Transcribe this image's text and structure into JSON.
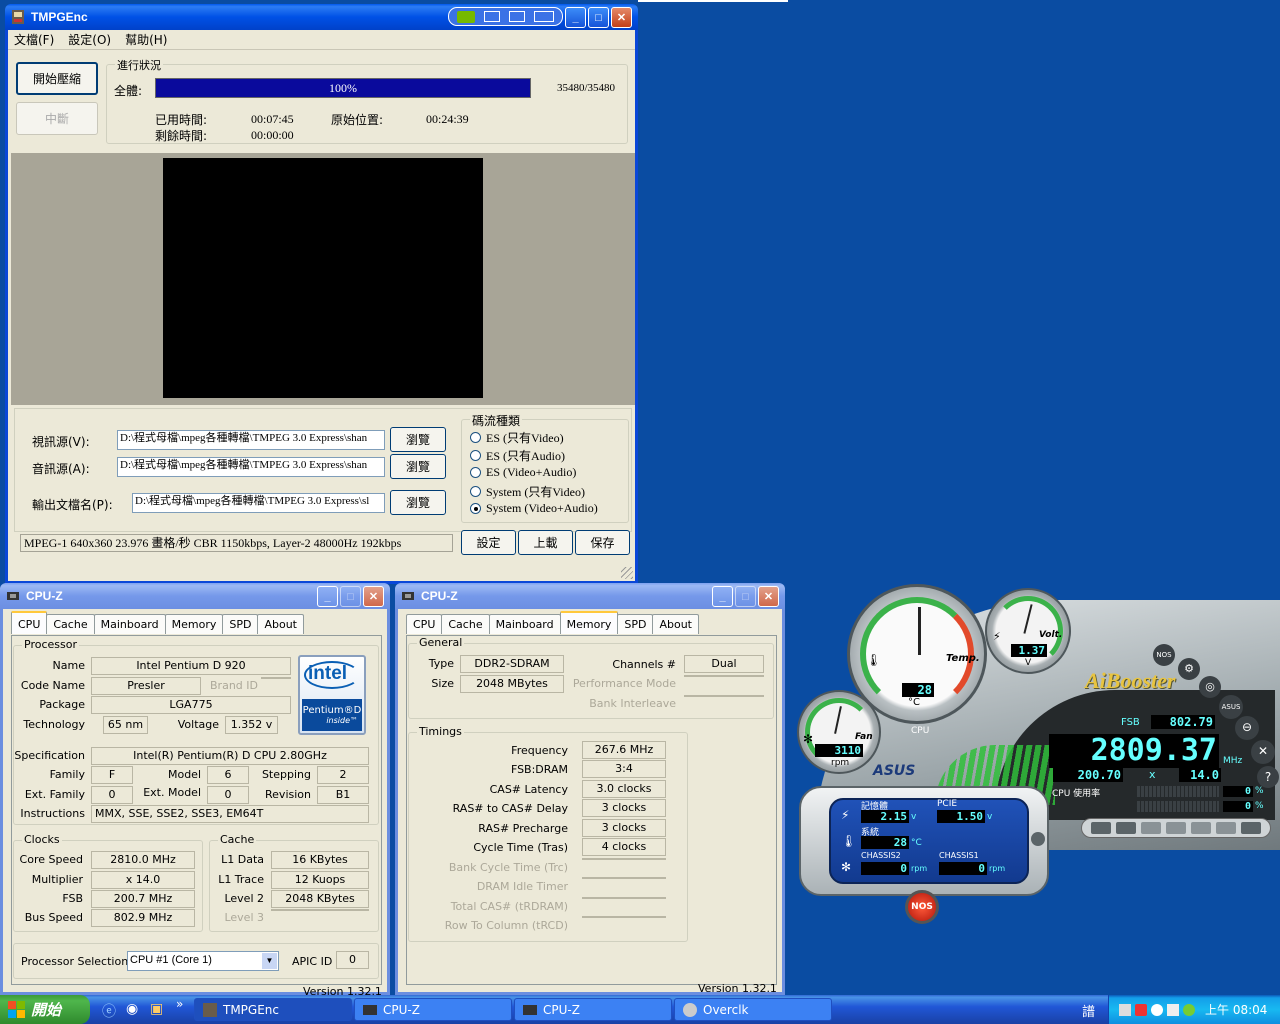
{
  "tmpg": {
    "title": "TMPGEnc",
    "menu": [
      "文檔(F)",
      "設定(O)",
      "幫助(H)"
    ],
    "start_btn": "開始壓縮",
    "stop_btn": "中斷",
    "progress_group": "進行狀況",
    "total_label": "全體:",
    "progress_pct": "100%",
    "progress_fraction": 1.0,
    "frames": "35480/35480",
    "elapsed_label": "已用時間:",
    "elapsed": "00:07:45",
    "remain_label": "剩餘時間:",
    "remain": "00:00:00",
    "orig_pos_label": "原始位置:",
    "orig_pos": "00:24:39",
    "video_label": "視訊源(V):",
    "video_path": "D:\\程式母檔\\mpeg各種轉檔\\TMPEG 3.0 Express\\shan",
    "audio_label": "音訊源(A):",
    "audio_path": "D:\\程式母檔\\mpeg各種轉檔\\TMPEG 3.0 Express\\shan",
    "output_label": "輸出文檔名(P):",
    "output_path": "D:\\程式母檔\\mpeg各種轉檔\\TMPEG 3.0 Express\\sl",
    "browse": "瀏覽",
    "stream_group": "碼流種類",
    "stream_options": [
      "ES (只有Video)",
      "ES (只有Audio)",
      "ES (Video+Audio)",
      "System (只有Video)",
      "System (Video+Audio)"
    ],
    "stream_selected": 4,
    "status": "MPEG-1 640x360 23.976 畫格/秒 CBR 1150kbps, Layer-2 48000Hz 192kbps",
    "setting_btn": "設定",
    "load_btn": "上載",
    "save_btn": "保存"
  },
  "cpuz1": {
    "title": "CPU-Z",
    "tabs": [
      "CPU",
      "Cache",
      "Mainboard",
      "Memory",
      "SPD",
      "About"
    ],
    "active_tab": 0,
    "processor_group": "Processor",
    "name_label": "Name",
    "name": "Intel Pentium D 920",
    "codename_label": "Code Name",
    "codename": "Presler",
    "brandid_label": "Brand ID",
    "package_label": "Package",
    "package": "LGA775",
    "tech_label": "Technology",
    "tech": "65 nm",
    "voltage_label": "Voltage",
    "voltage": "1.352 v",
    "spec_label": "Specification",
    "spec": "Intel(R) Pentium(R) D CPU 2.80GHz",
    "family_label": "Family",
    "family": "F",
    "model_label": "Model",
    "model": "6",
    "stepping_label": "Stepping",
    "stepping": "2",
    "extfamily_label": "Ext. Family",
    "extfamily": "0",
    "extmodel_label": "Ext. Model",
    "extmodel": "0",
    "revision_label": "Revision",
    "revision": "B1",
    "instr_label": "Instructions",
    "instr": "MMX, SSE, SSE2, SSE3, EM64T",
    "logo_intel": "intel",
    "logo_line": "Pentium®D",
    "logo_inside": "inside™",
    "clocks_group": "Clocks",
    "corespeed_label": "Core Speed",
    "corespeed": "2810.0 MHz",
    "multiplier_label": "Multiplier",
    "multiplier": "x 14.0",
    "fsb_label": "FSB",
    "fsb": "200.7 MHz",
    "busspeed_label": "Bus Speed",
    "busspeed": "802.9 MHz",
    "cache_group": "Cache",
    "l1d_label": "L1 Data",
    "l1d": "16 KBytes",
    "l1t_label": "L1 Trace",
    "l1t": "12 Kuops",
    "l2_label": "Level 2",
    "l2": "2048 KBytes",
    "l3_label": "Level 3",
    "procsel_label": "Processor Selection",
    "procsel": "CPU #1 (Core 1)",
    "apic_label": "APIC ID",
    "apic": "0",
    "version": "Version 1.32.1"
  },
  "cpuz2": {
    "title": "CPU-Z",
    "tabs": [
      "CPU",
      "Cache",
      "Mainboard",
      "Memory",
      "SPD",
      "About"
    ],
    "active_tab": 3,
    "general_group": "General",
    "type_label": "Type",
    "type": "DDR2-SDRAM",
    "size_label": "Size",
    "size": "2048 MBytes",
    "channels_label": "Channels #",
    "channels": "Dual",
    "perfmode_label": "Performance Mode",
    "bankint_label": "Bank Interleave",
    "timings_group": "Timings",
    "freq_label": "Frequency",
    "freq": "267.6 MHz",
    "fsbdram_label": "FSB:DRAM",
    "fsbdram": "3:4",
    "cas_label": "CAS# Latency",
    "cas": "3.0 clocks",
    "rcd_label": "RAS# to CAS# Delay",
    "rcd": "3 clocks",
    "rp_label": "RAS# Precharge",
    "rp": "3 clocks",
    "tras_label": "Cycle Time (Tras)",
    "tras": "4 clocks",
    "trc_label": "Bank Cycle Time (Trc)",
    "idle_label": "DRAM Idle Timer",
    "trdram_label": "Total CAS# (tRDRAM)",
    "trcd2_label": "Row To Column (tRCD)",
    "version": "Version 1.32.1"
  },
  "aibooster": {
    "temp_label": "Temp.",
    "cpu_temp": "28",
    "temp_unit": "°C",
    "cpu_label": "CPU",
    "volt_label": "Volt.",
    "volt": "1.37",
    "volt_unit": "V",
    "fan_label": "Fan",
    "fan": "3110",
    "fan_unit": "rpm",
    "brand": "AiBooster",
    "asus": "ASUS",
    "asus_small": "ASUS",
    "nos_small": "NOS",
    "fsb_label": "FSB",
    "fsb": "802.79",
    "cpu_mhz": "2809.37",
    "mhz_unit": "MHz",
    "base": "200.70",
    "x": "x",
    "mult": "14.0",
    "cpu_usage_label": "CPU 使用率",
    "usage1": "0",
    "usage2": "0",
    "pct": "%",
    "mem_label": "記憶體",
    "mem_v": "2.15",
    "pcie_label": "PCIE",
    "pcie_v": "1.50",
    "v_unit": "v",
    "sys_label": "系統",
    "sys_temp": "28",
    "c_unit": "°C",
    "chassis2_label": "CHASSIS2",
    "chassis2": "0",
    "chassis1_label": "CHASSIS1",
    "chassis1": "0",
    "rpm": "rpm",
    "nos": "NOS"
  },
  "taskbar": {
    "start": "開始",
    "items": [
      "TMPGEnc",
      "CPU-Z",
      "CPU-Z",
      "Overclk"
    ],
    "ime": "譜",
    "clock": "上午 08:04",
    "quick_more": "»"
  }
}
